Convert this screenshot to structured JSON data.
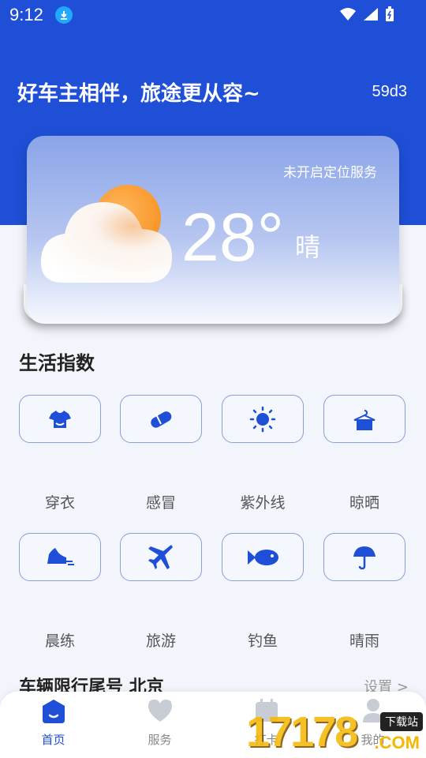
{
  "status": {
    "time": "9:12"
  },
  "header": {
    "slogan": "好车主相伴，旅途更从容~",
    "code": "59d3"
  },
  "weather": {
    "location_notice": "未开启定位服务",
    "temperature": "28°",
    "condition": "晴"
  },
  "life_index": {
    "title": "生活指数",
    "items": [
      {
        "label": "穿衣",
        "icon": "shirt-icon"
      },
      {
        "label": "感冒",
        "icon": "pill-icon"
      },
      {
        "label": "紫外线",
        "icon": "sun-icon"
      },
      {
        "label": "晾晒",
        "icon": "hanger-icon"
      },
      {
        "label": "晨练",
        "icon": "shoe-icon"
      },
      {
        "label": "旅游",
        "icon": "plane-icon"
      },
      {
        "label": "钓鱼",
        "icon": "fish-icon"
      },
      {
        "label": "晴雨",
        "icon": "umbrella-icon"
      }
    ]
  },
  "restriction": {
    "title": "车辆限行尾号 北京",
    "setting": "设置 >"
  },
  "tabbar": {
    "tabs": [
      {
        "label": "首页",
        "active": true
      },
      {
        "label": "服务",
        "active": false
      },
      {
        "label": "打卡",
        "active": false
      },
      {
        "label": "我的",
        "active": false
      }
    ]
  },
  "watermark": {
    "number": "17178",
    "badge": "下载站",
    "suffix": ".COM"
  },
  "colors": {
    "primary": "#1e4fd6",
    "tile_border": "#8aa0d6",
    "sun": "#f58a17"
  }
}
